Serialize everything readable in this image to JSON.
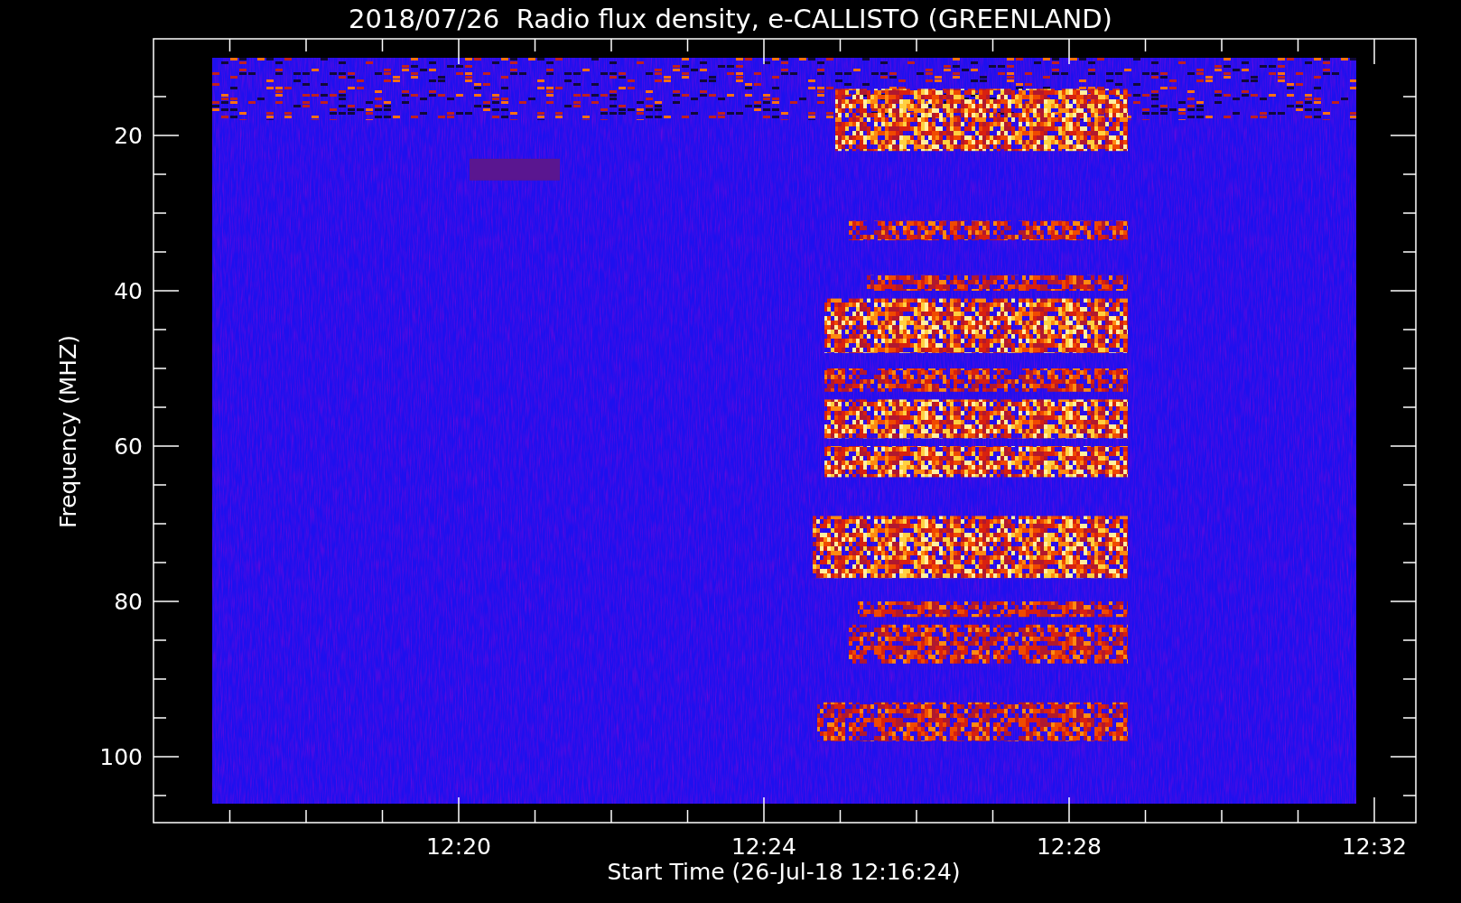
{
  "plot": {
    "title": "2018/07/26  Radio flux density, e-CALLISTO (GREENLAND)",
    "xlabel": "Start Time (26-Jul-18 12:16:24)",
    "ylabel": "Frequency (MHZ)",
    "xtick_labels": [
      "12:20",
      "12:24",
      "12:28",
      "12:32"
    ],
    "ytick_labels": [
      "20",
      "40",
      "60",
      "80",
      "100"
    ]
  }
}
